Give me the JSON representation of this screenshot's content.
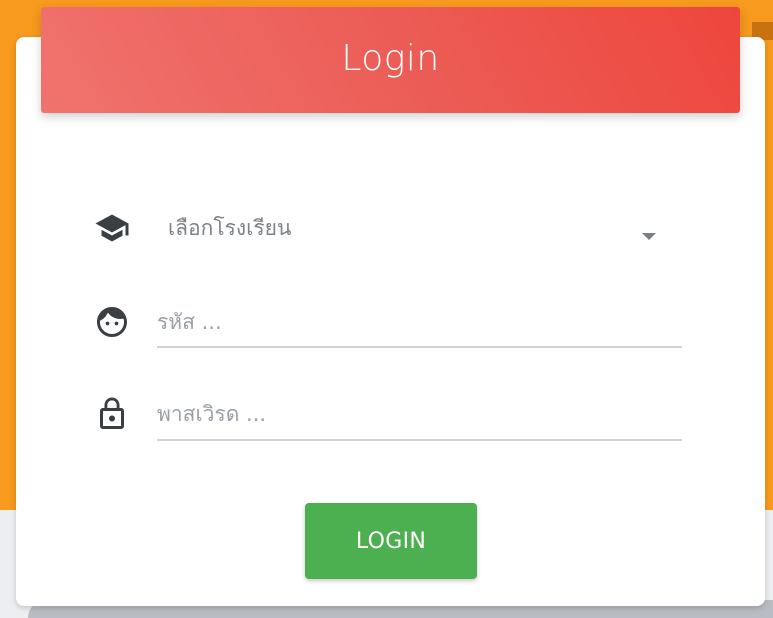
{
  "header": {
    "title": "Login"
  },
  "form": {
    "school": {
      "icon": "graduation-cap-icon",
      "selected": "เลือกโรงเรียน"
    },
    "code": {
      "icon": "face-icon",
      "placeholder": "รหัส ..."
    },
    "password": {
      "icon": "lock-icon",
      "placeholder": "พาสเวิรด ..."
    },
    "submit_label": "LOGIN"
  },
  "colors": {
    "header_gradient_start": "#f0736e",
    "header_gradient_end": "#ee463c",
    "background": "#f79a1e",
    "button": "#4caf50"
  }
}
